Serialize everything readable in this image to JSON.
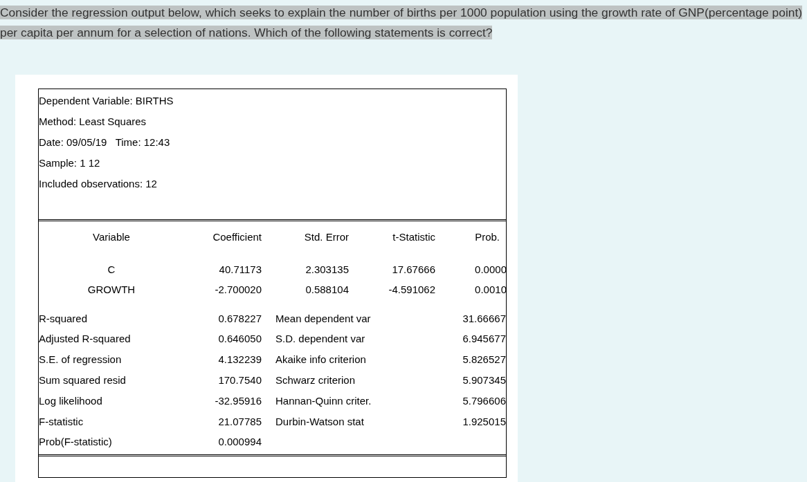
{
  "question": "Consider the regression output below, which seeks to explain the number of births per 1000 population using the growth rate of GNP(percentage point)  per capita per annum for a selection of nations.  Which of the following statements is  correct?",
  "output_header": [
    "Dependent Variable: BIRTHS",
    "Method: Least Squares",
    "Date: 09/05/19   Time: 12:43",
    "Sample: 1 12",
    "Included observations: 12"
  ],
  "coefficients": {
    "columns": [
      "Variable",
      "Coefficient",
      "Std. Error",
      "t-Statistic",
      "Prob."
    ],
    "rows": [
      [
        "C",
        "40.71173",
        "2.303135",
        "17.67666",
        "0.0000"
      ],
      [
        "GROWTH",
        "-2.700020",
        "0.588104",
        "-4.591062",
        "0.0010"
      ]
    ]
  },
  "statistics": [
    [
      "R-squared",
      "0.678227",
      "Mean dependent var",
      "31.66667"
    ],
    [
      "Adjusted R-squared",
      "0.646050",
      "S.D. dependent var",
      "6.945677"
    ],
    [
      "S.E. of regression",
      "4.132239",
      "Akaike info criterion",
      "5.826527"
    ],
    [
      "Sum squared resid",
      "170.7540",
      "Schwarz criterion",
      "5.907345"
    ],
    [
      "Log likelihood",
      "-32.95916",
      "Hannan-Quinn criter.",
      "5.796606"
    ],
    [
      "F-statistic",
      "21.07785",
      "Durbin-Watson stat",
      "1.925015"
    ],
    [
      "Prob(F-statistic)",
      "0.000994"
    ]
  ]
}
